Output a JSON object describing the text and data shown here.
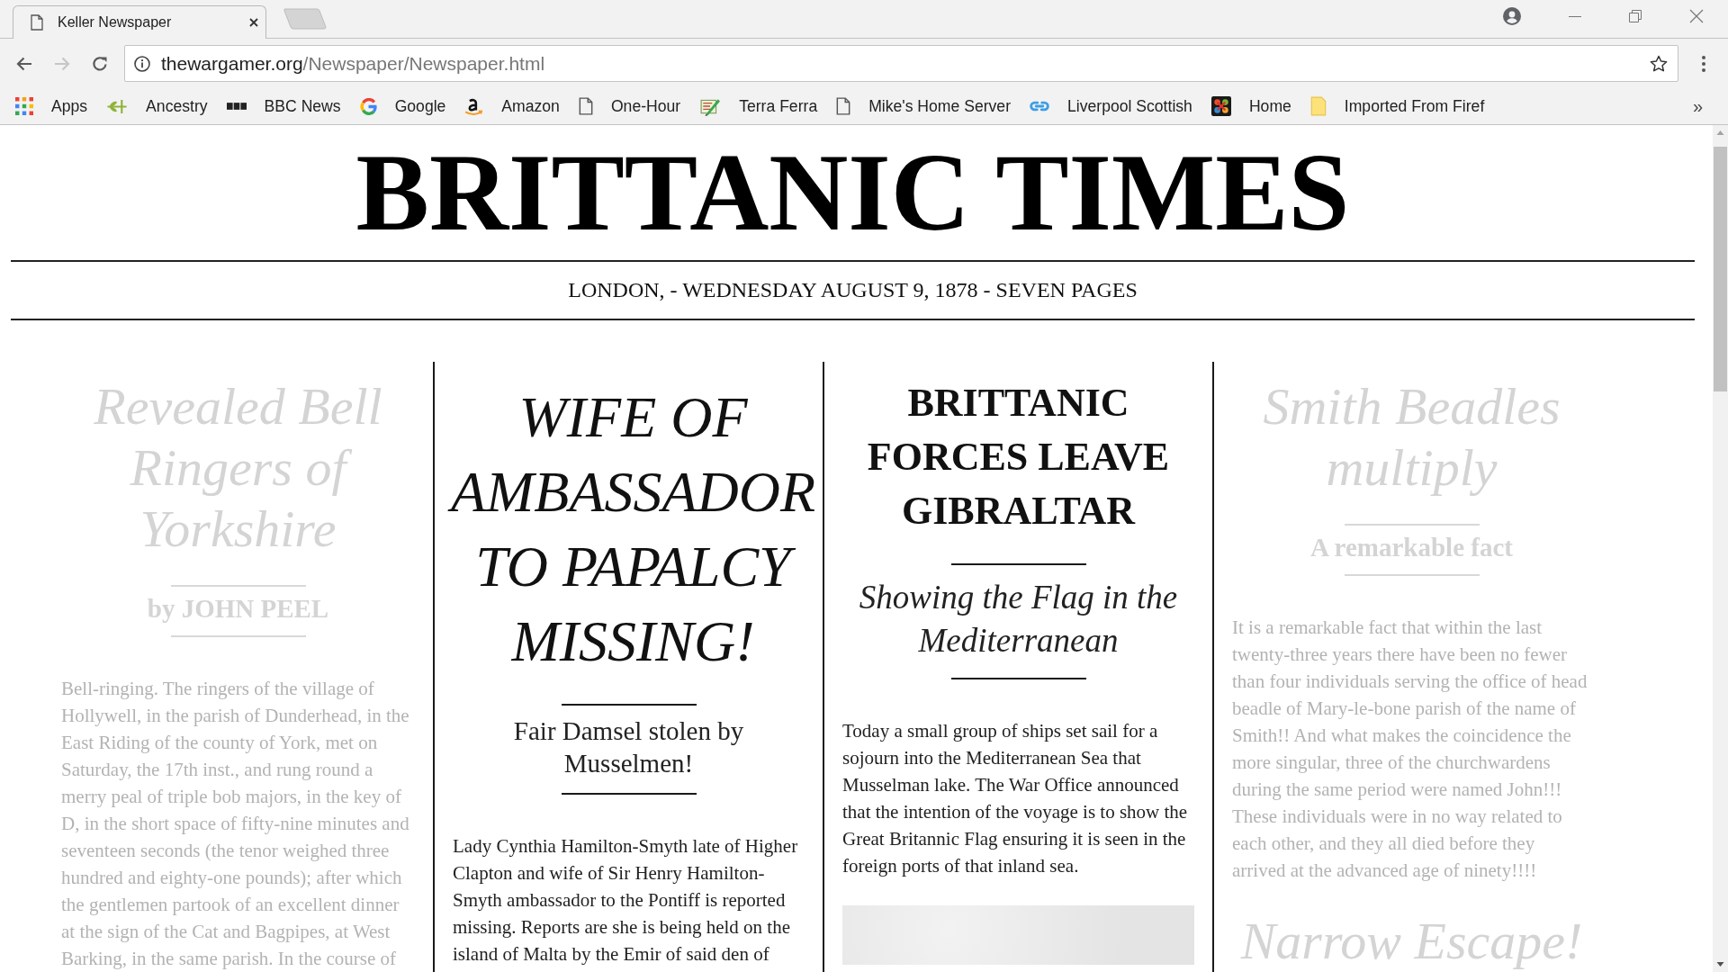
{
  "browser": {
    "tabs": [
      {
        "title": "Keller Newspaper",
        "selected": true
      }
    ],
    "nav": [
      {
        "kind": "back",
        "disabled": false
      },
      {
        "kind": "forward",
        "disabled": true
      },
      {
        "kind": "reload",
        "disabled": false
      }
    ],
    "url": {
      "host": "thewargamer.org",
      "path": "/Newspaper/Newspaper.html"
    },
    "bookmarks": [
      {
        "label": "Apps",
        "kind": "apps"
      },
      {
        "label": "Ancestry",
        "kind": "leaf"
      },
      {
        "label": "BBC News",
        "kind": "blocks"
      },
      {
        "label": "Google",
        "kind": "g"
      },
      {
        "label": "Amazon",
        "kind": "smile"
      },
      {
        "label": "One-Hour",
        "kind": "page"
      },
      {
        "label": "Terra Ferra",
        "kind": "map"
      },
      {
        "label": "Mike's Home Server",
        "kind": "page"
      },
      {
        "label": "Liverpool Scottish",
        "kind": "chain"
      },
      {
        "label": "Home",
        "kind": "tile"
      },
      {
        "label": "Imported From Firef",
        "kind": "folder"
      }
    ],
    "bookmarks_overflow": "»"
  },
  "newspaper": {
    "masthead": "BRITTANIC TIMES",
    "dateline": "LONDON, - WEDNESDAY AUGUST 9, 1878 - SEVEN PAGES",
    "columns": [
      {
        "faded": true,
        "blocks": [
          {
            "kind": "headline",
            "italic": true,
            "text": "Revealed Bell Ringers of Yorkshire"
          },
          {
            "kind": "byline",
            "text": "by JOHN PEEL"
          },
          {
            "kind": "body",
            "text": "Bell-ringing. The ringers of the village of Hollywell, in the parish of Dunderhead, in the East Riding of the county of York, met on Saturday, the 17th inst., and rung round a merry peal of triple bob majors, in the key of D, in the short space of fifty-nine minutes and seventeen seconds (the tenor weighed three hundred and eighty-one pounds); after which the gentlemen partook of an excellent dinner at the sign of the Cat and Bagpipes, at West Barking, in the same parish. In the course of"
          }
        ]
      },
      {
        "faded": false,
        "blocks": [
          {
            "kind": "headline",
            "italic": true,
            "text": "WIFE OF AMBASSADOR TO PAPALCY MISSING!"
          },
          {
            "kind": "deck",
            "italic": false,
            "text": "Fair Damsel stolen by Musselmen!"
          },
          {
            "kind": "body",
            "text": "Lady Cynthia Hamilton-Smyth late of Higher Clapton and wife of Sir Henry Hamilton-Smyth ambassador to the Pontiff is reported missing. Reports are she is being held on the island of Malta by the Emir of said den of"
          }
        ]
      },
      {
        "faded": false,
        "blocks": [
          {
            "kind": "headline",
            "italic": false,
            "text": "BRITTANIC FORCES LEAVE GIBRALTAR"
          },
          {
            "kind": "deck",
            "italic": true,
            "text": "Showing the Flag in the Mediterranean"
          },
          {
            "kind": "body",
            "text": "Today a small group of ships set sail for a sojourn into the Mediterranean Sea that Musselman lake. The War Office announced that the intention of the voyage is to show the Great Britannic Flag ensuring it is seen in the foreign ports of that inland sea."
          },
          {
            "kind": "photo"
          }
        ]
      },
      {
        "faded": true,
        "blocks": [
          {
            "kind": "headline",
            "italic": true,
            "text": "Smith Beadles multiply"
          },
          {
            "kind": "byline",
            "text": "A remarkable fact"
          },
          {
            "kind": "body",
            "text": "It is a remarkable fact that within the last twenty-three years there have been no fewer than four individuals serving the office of head beadle of Mary-le-bone parish of the name of Smith!! And what makes the coincidence the more singular, three of the churchwardens during the same period were named John!!! These individuals were in no way related to each other, and they all died before they arrived at the advanced age of ninety!!!!"
          },
          {
            "kind": "headline",
            "italic": true,
            "text": "Narrow Escape!"
          }
        ]
      }
    ]
  }
}
